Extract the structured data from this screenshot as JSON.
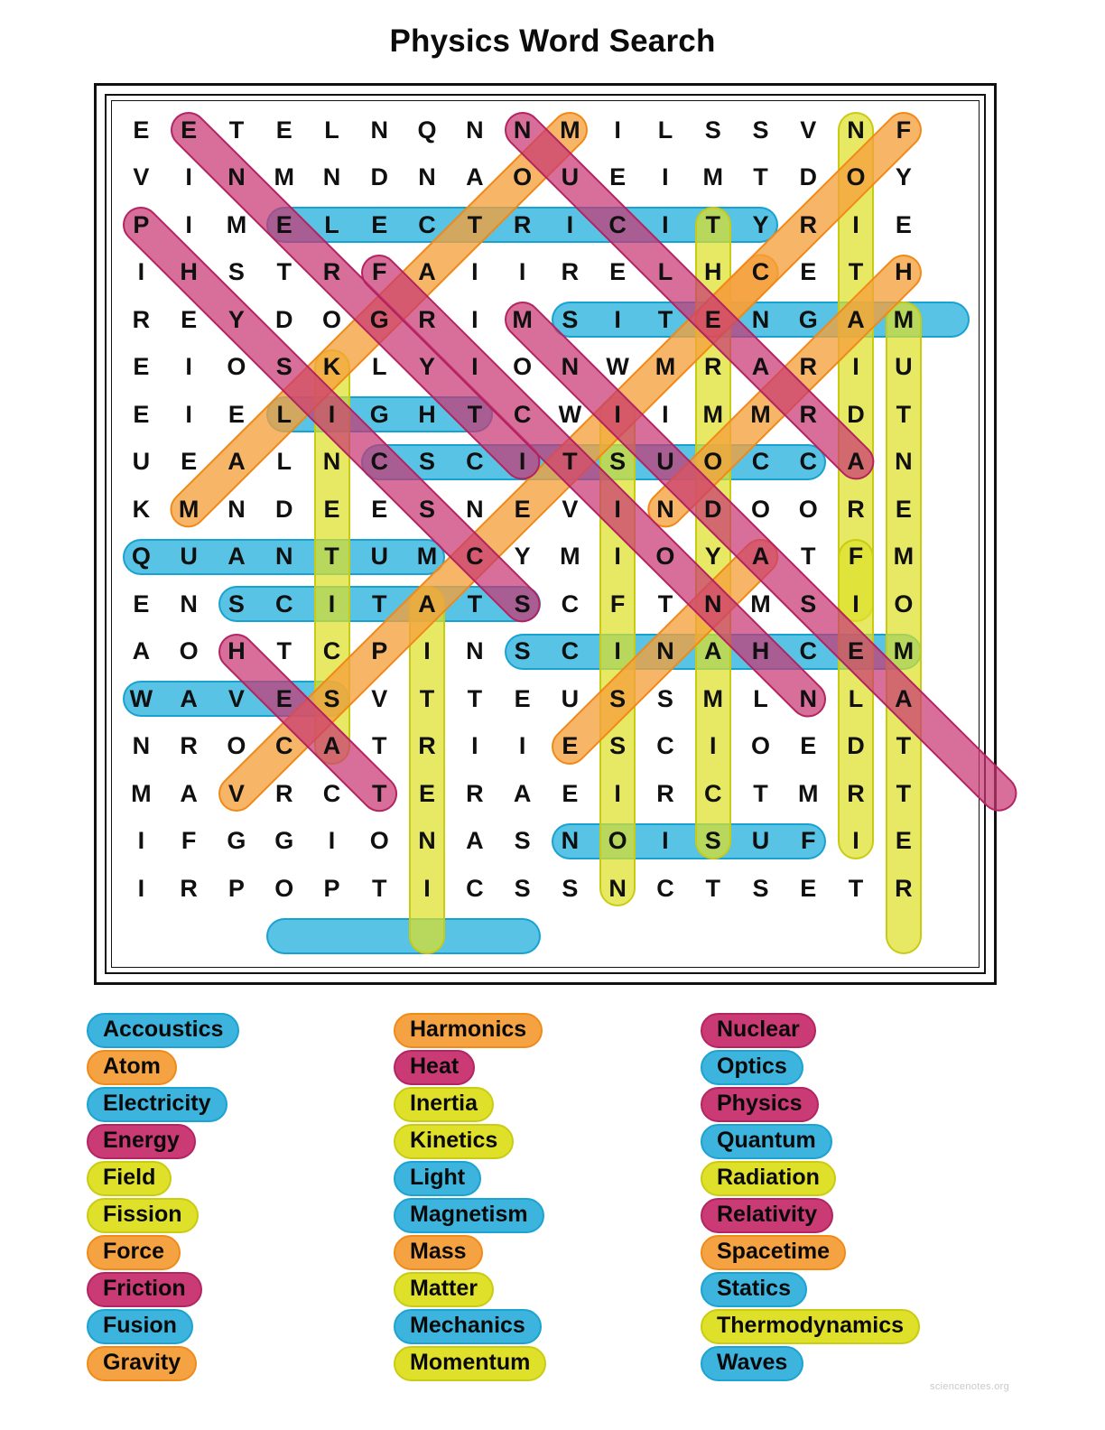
{
  "page": {
    "title": "Physics Word Search",
    "watermark": "sciencenotes.org"
  },
  "grid": {
    "rows": 18,
    "cols": 18,
    "letters": [
      [
        "E",
        "E",
        "T",
        "E",
        "L",
        "N",
        "Q",
        "N",
        "N",
        "M",
        "I",
        "L",
        "S",
        "S",
        "V",
        "N",
        "F",
        ""
      ],
      [
        "V",
        "I",
        "N",
        "M",
        "N",
        "D",
        "N",
        "A",
        "O",
        "U",
        "E",
        "I",
        "M",
        "T",
        "D",
        "O",
        "Y",
        ""
      ],
      [
        "P",
        "I",
        "M",
        "E",
        "L",
        "E",
        "C",
        "T",
        "R",
        "I",
        "C",
        "I",
        "T",
        "Y",
        "R",
        "I",
        "E",
        ""
      ],
      [
        "I",
        "H",
        "S",
        "T",
        "R",
        "F",
        "A",
        "I",
        "I",
        "R",
        "E",
        "L",
        "H",
        "C",
        "E",
        "T",
        "H",
        ""
      ],
      [
        "R",
        "E",
        "Y",
        "D",
        "O",
        "G",
        "R",
        "I",
        "M",
        "S",
        "I",
        "T",
        "E",
        "N",
        "G",
        "A",
        "M",
        ""
      ],
      [
        "E",
        "I",
        "O",
        "S",
        "K",
        "L",
        "Y",
        "I",
        "O",
        "N",
        "W",
        "M",
        "R",
        "A",
        "R",
        "I",
        "U",
        ""
      ],
      [
        "E",
        "I",
        "E",
        "L",
        "I",
        "G",
        "H",
        "T",
        "C",
        "W",
        "I",
        "I",
        "M",
        "M",
        "R",
        "D",
        "T",
        ""
      ],
      [
        "U",
        "E",
        "A",
        "L",
        "N",
        "C",
        "S",
        "C",
        "I",
        "T",
        "S",
        "U",
        "O",
        "C",
        "C",
        "A",
        "N",
        ""
      ],
      [
        "K",
        "M",
        "N",
        "D",
        "E",
        "E",
        "S",
        "N",
        "E",
        "V",
        "I",
        "N",
        "D",
        "O",
        "O",
        "R",
        "E",
        ""
      ],
      [
        "Q",
        "U",
        "A",
        "N",
        "T",
        "U",
        "M",
        "C",
        "Y",
        "M",
        "I",
        "O",
        "Y",
        "A",
        "T",
        "F",
        "M",
        ""
      ],
      [
        "E",
        "N",
        "S",
        "C",
        "I",
        "T",
        "A",
        "T",
        "S",
        "C",
        "F",
        "T",
        "N",
        "M",
        "S",
        "I",
        "O",
        ""
      ],
      [
        "A",
        "O",
        "H",
        "T",
        "C",
        "P",
        "I",
        "N",
        "S",
        "C",
        "I",
        "N",
        "A",
        "H",
        "C",
        "E",
        "M",
        ""
      ],
      [
        "W",
        "A",
        "V",
        "E",
        "S",
        "V",
        "T",
        "T",
        "E",
        "U",
        "S",
        "S",
        "M",
        "L",
        "N",
        "L",
        "A",
        ""
      ],
      [
        "N",
        "R",
        "O",
        "C",
        "A",
        "T",
        "R",
        "I",
        "I",
        "E",
        "S",
        "C",
        "I",
        "O",
        "E",
        "D",
        "T",
        ""
      ],
      [
        "M",
        "A",
        "V",
        "R",
        "C",
        "T",
        "E",
        "R",
        "A",
        "E",
        "I",
        "R",
        "C",
        "T",
        "M",
        "R",
        "T",
        ""
      ],
      [
        "I",
        "F",
        "G",
        "G",
        "I",
        "O",
        "N",
        "A",
        "S",
        "N",
        "O",
        "I",
        "S",
        "U",
        "F",
        "I",
        "E",
        ""
      ],
      [
        "I",
        "R",
        "P",
        "O",
        "P",
        "T",
        "I",
        "C",
        "S",
        "S",
        "N",
        "C",
        "T",
        "S",
        "E",
        "T",
        "R",
        ""
      ]
    ]
  },
  "highlights": [
    {
      "word": "ELECTRICITY",
      "color": "blue",
      "row": 2,
      "col": 3,
      "len": 11,
      "dir": "h"
    },
    {
      "word": "MAGNETISM",
      "color": "blue",
      "row": 4,
      "col": 9,
      "len": 9,
      "dir": "h"
    },
    {
      "word": "LIGHT",
      "color": "blue",
      "row": 6,
      "col": 3,
      "len": 5,
      "dir": "h"
    },
    {
      "word": "ACCOUSTICS",
      "color": "blue",
      "row": 7,
      "col": 5,
      "len": 10,
      "dir": "h"
    },
    {
      "word": "QUANTUM",
      "color": "blue",
      "row": 9,
      "col": 0,
      "len": 7,
      "dir": "h"
    },
    {
      "word": "STATICS",
      "color": "blue",
      "row": 10,
      "col": 2,
      "len": 7,
      "dir": "h"
    },
    {
      "word": "MECHANICS",
      "color": "blue",
      "row": 11,
      "col": 8,
      "len": 9,
      "dir": "h"
    },
    {
      "word": "WAVES",
      "color": "blue",
      "row": 12,
      "col": 0,
      "len": 5,
      "dir": "h"
    },
    {
      "word": "FUSION",
      "color": "blue",
      "row": 15,
      "col": 9,
      "len": 6,
      "dir": "h"
    },
    {
      "word": "OPTICS",
      "color": "blue",
      "row": 17,
      "col": 3,
      "len": 6,
      "dir": "h"
    },
    {
      "word": "INERTIA",
      "color": "yellow",
      "row": 5,
      "col": 4,
      "len": 9,
      "dir": "v"
    },
    {
      "word": "KINETICS",
      "color": "yellow",
      "row": 10,
      "col": 6,
      "len": 8,
      "dir": "v"
    },
    {
      "word": "RADIATION",
      "color": "yellow",
      "row": 0,
      "col": 15,
      "len": 11,
      "dir": "v"
    },
    {
      "word": "FIELD",
      "color": "yellow",
      "row": 9,
      "col": 15,
      "len": 7,
      "dir": "v"
    },
    {
      "word": "MATTER",
      "color": "yellow",
      "row": 4,
      "col": 16,
      "len": 14,
      "dir": "v"
    },
    {
      "word": "THERMODYNAMICS",
      "color": "yellow",
      "row": 2,
      "col": 12,
      "len": 14,
      "dir": "v"
    },
    {
      "word": "MOMENTUM",
      "color": "yellow",
      "row": 6,
      "col": 10,
      "len": 11,
      "dir": "v"
    },
    {
      "word": "HARMONICS",
      "color": "orange",
      "row": 0,
      "col": 9,
      "len": 9,
      "dir": "d-dl"
    },
    {
      "word": "SPACETIME",
      "color": "orange",
      "row": 14,
      "col": 2,
      "len": 12,
      "dir": "d-ur"
    },
    {
      "word": "ATOM",
      "color": "orange",
      "row": 0,
      "col": 16,
      "len": 5,
      "dir": "d-dl"
    },
    {
      "word": "FORCE",
      "color": "orange",
      "row": 3,
      "col": 16,
      "len": 6,
      "dir": "d-dl"
    },
    {
      "word": "MASS",
      "color": "orange",
      "row": 13,
      "col": 9,
      "len": 5,
      "dir": "d-ur"
    },
    {
      "word": "PHYSICS",
      "color": "pink",
      "row": 0,
      "col": 1,
      "len": 8,
      "dir": "d-dr"
    },
    {
      "word": "ENERGY",
      "color": "pink",
      "row": 2,
      "col": 0,
      "len": 9,
      "dir": "d-dr"
    },
    {
      "word": "FRICTION",
      "color": "pink",
      "row": 3,
      "col": 5,
      "len": 10,
      "dir": "d-dr"
    },
    {
      "word": "NUCLEAR",
      "color": "pink",
      "row": 0,
      "col": 8,
      "len": 8,
      "dir": "d-dr"
    },
    {
      "word": "RELATIVITY",
      "color": "pink",
      "row": 4,
      "col": 8,
      "len": 11,
      "dir": "d-dr"
    },
    {
      "word": "HEAT",
      "color": "pink",
      "row": 11,
      "col": 2,
      "len": 4,
      "dir": "d-dr"
    }
  ],
  "wordlist": {
    "columns": [
      {
        "items": [
          {
            "label": "Accoustics",
            "color": "blue"
          },
          {
            "label": "Atom",
            "color": "orange"
          },
          {
            "label": "Electricity",
            "color": "blue"
          },
          {
            "label": "Energy",
            "color": "pink"
          },
          {
            "label": "Field",
            "color": "yellow"
          },
          {
            "label": "Fission",
            "color": "yellow"
          },
          {
            "label": "Force",
            "color": "orange"
          },
          {
            "label": "Friction",
            "color": "pink"
          },
          {
            "label": "Fusion",
            "color": "blue"
          },
          {
            "label": "Gravity",
            "color": "orange"
          }
        ]
      },
      {
        "items": [
          {
            "label": "Harmonics",
            "color": "orange"
          },
          {
            "label": "Heat",
            "color": "pink"
          },
          {
            "label": "Inertia",
            "color": "yellow"
          },
          {
            "label": "Kinetics",
            "color": "yellow"
          },
          {
            "label": "Light",
            "color": "blue"
          },
          {
            "label": "Magnetism",
            "color": "blue"
          },
          {
            "label": "Mass",
            "color": "orange"
          },
          {
            "label": "Matter",
            "color": "yellow"
          },
          {
            "label": "Mechanics",
            "color": "blue"
          },
          {
            "label": "Momentum",
            "color": "yellow"
          }
        ]
      },
      {
        "items": [
          {
            "label": "Nuclear",
            "color": "pink"
          },
          {
            "label": "Optics",
            "color": "blue"
          },
          {
            "label": "Physics",
            "color": "pink"
          },
          {
            "label": "Quantum",
            "color": "blue"
          },
          {
            "label": "Radiation",
            "color": "yellow"
          },
          {
            "label": "Relativity",
            "color": "pink"
          },
          {
            "label": "Spacetime",
            "color": "orange"
          },
          {
            "label": "Statics",
            "color": "blue"
          },
          {
            "label": "Thermodynamics",
            "color": "yellow"
          },
          {
            "label": "Waves",
            "color": "blue"
          }
        ]
      }
    ]
  },
  "colors": {
    "blue": "#3cb4dd",
    "orange": "#f5a242",
    "pink": "#ca3a75",
    "yellow": "#dfe02a",
    "letter": "#101010",
    "frame": "#111111"
  }
}
